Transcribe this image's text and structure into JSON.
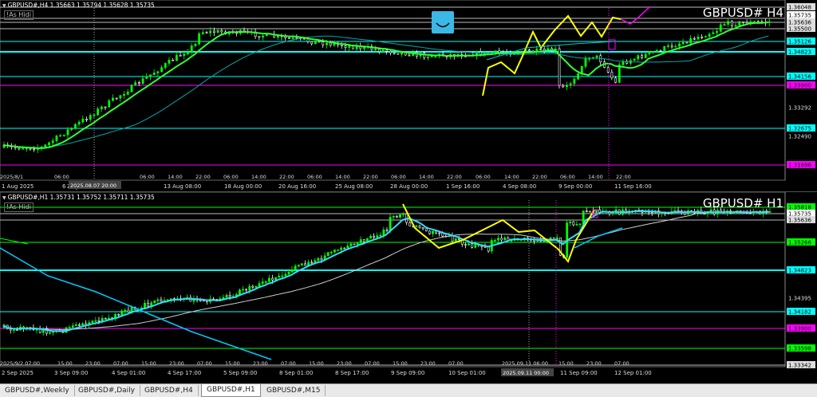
{
  "h4": {
    "header": "GBPUSD#,H4  1.35663 1.35794 1.35628 1.35735",
    "as_hidden": "!As Hidi",
    "symbol_title": "GBPUSD# H4",
    "price_labels": [
      "1.36048",
      "1.35735",
      "1.35636",
      "1.35500",
      "1.35126",
      "1.34823",
      "1.34156",
      "1.33900",
      "1.33292",
      "1.32675",
      "1.32490",
      "1.31696"
    ],
    "price_label_colors": [
      "#dddddd",
      "#ffffff",
      "#dddddd",
      "#dddddd",
      "#00ffff",
      "#00ffff",
      "#00ffff",
      "#ff00ff",
      "#000000",
      "#00ffff",
      "#000000",
      "#ff00ff"
    ],
    "time_labels": [
      "1 Aug 2025",
      "6 Aug",
      "2025.08.08 02:00",
      "13 Aug 08:00",
      "18 Aug 00:00",
      "20 Aug 16:00",
      "25 Aug 08:00",
      "28 Aug 00:00",
      "1 Sep 16:00",
      "4 Sep 08:00",
      "9 Sep 00:00",
      "11 Sep 16:00"
    ],
    "top_time_labels": [
      "2025/8/1",
      "06:00",
      "06:00",
      "14:00",
      "22:00",
      "06:00",
      "14:00",
      "22:00",
      "06:00",
      "14:00",
      "22:00",
      "06:00",
      "14:00",
      "22:00",
      "06:00",
      "14:00",
      "22:00",
      "06:00",
      "14:00",
      "22:00"
    ],
    "overlay_time": "2025.08.07 20:00"
  },
  "h1": {
    "header": "GBPUSD#,H1  1.35731 1.35752 1.35711 1.35735",
    "as_hidden": "!As Hidi",
    "symbol_title": "GBPUSD# H1",
    "price_labels": [
      "1.35818",
      "1.35735",
      "1.35636",
      "1.35266",
      "1.34823",
      "1.34395",
      "1.34182",
      "1.33900",
      "1.33598",
      "1.33342"
    ],
    "price_label_colors": [
      "#00ff00",
      "#ffffff",
      "#dddddd",
      "#00ff00",
      "#00ffff",
      "#000000",
      "#00ffff",
      "#ff00ff",
      "#00ff00",
      "#dddddd"
    ],
    "time_labels": [
      "2 Sep 2025",
      "3 Sep 09:00",
      "4 Sep 01:00",
      "4 Sep 17:00",
      "5 Sep 09:00",
      "8 Sep 01:00",
      "8 Sep 17:00",
      "9 Sep 09:00",
      "10 Sep 01:00",
      "2025.09.11 00:00",
      "11 Sep 09:00",
      "12 Sep 01:00"
    ],
    "top_time_labels": [
      "2025/9/2 07:00",
      "15:00",
      "23:00",
      "07:00",
      "15:00",
      "23:00",
      "07:00",
      "15:00",
      "23:00",
      "07:00",
      "15:00",
      "23:00",
      "07:00",
      "15:00",
      "23:00",
      "07:00",
      "2025.09.11 06:00",
      "15:00",
      "23:00",
      "07:00"
    ]
  },
  "tabs": [
    "GBPUSD#,Weekly",
    "GBPUSD#,Daily",
    "GBPUSD#,H4",
    "GBPUSD#,H1",
    "GBPUSD#,M15"
  ],
  "active_tab": 3,
  "colors": {
    "bull": "#00ff00",
    "bear": "#ffffff",
    "ma_fast": "#33ff33",
    "ma_slow": "#00cccc",
    "zigzag": "#ffff00",
    "cyan": "#00ffff",
    "magenta": "#ff00ff"
  }
}
